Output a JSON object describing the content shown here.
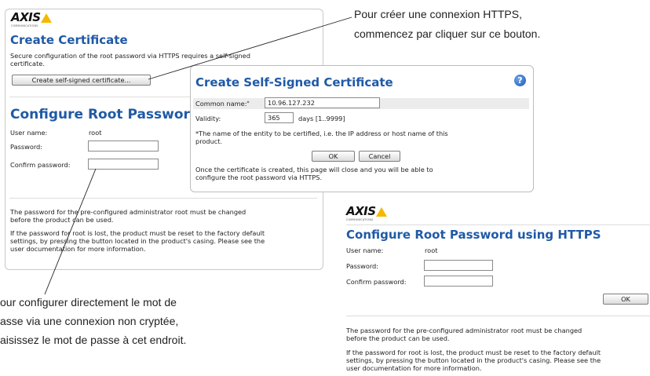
{
  "brand": {
    "name": "AXIS",
    "tagline": "COMMUNICATIONS",
    "accent": "#f5b800"
  },
  "colors": {
    "heading": "#1f5aa6",
    "help_icon": "#1f57b5"
  },
  "left_panel": {
    "create_certificate_title": "Create Certificate",
    "create_certificate_desc_1": "Secure configuration of the root password via HTTPS requires a self-signed",
    "create_certificate_desc_2": "certificate.",
    "create_button": "Create self-signed certificate...",
    "configure_title": "Configure Root Password",
    "user_name_label": "User name:",
    "user_name_value": "root",
    "password_label": "Password:",
    "confirm_label": "Confirm password:",
    "note_1a": "The password for the pre-configured administrator root must be changed",
    "note_1b": "before the product can be used.",
    "note_2a": "If the password for root is lost, the product must be reset to the factory default",
    "note_2b": "settings, by pressing the button located in the product's casing. Please see the",
    "note_2c": "user documentation for more information."
  },
  "dialog": {
    "title": "Create Self-Signed Certificate",
    "help_icon": "?",
    "common_name_label": "Common name:",
    "required_mark": "*",
    "common_name_value": "10.96.127.232",
    "validity_label": "Validity:",
    "validity_value": "365",
    "validity_unit": "days [1..9999]",
    "footnote_1": "*The name of the entity to be certified, i.e. the IP address or host name of this",
    "footnote_2": "product.",
    "ok": "OK",
    "cancel": "Cancel",
    "info_1": "Once the certificate is created, this page will close and you will be able to",
    "info_2": "configure the root password via HTTPS."
  },
  "https_panel": {
    "title": "Configure Root Password using HTTPS",
    "user_name_label": "User name:",
    "user_name_value": "root",
    "password_label": "Password:",
    "confirm_label": "Confirm password:",
    "ok": "OK",
    "note_1a": "The password for the pre-configured administrator root must be changed",
    "note_1b": "before the product can be used.",
    "note_2a": "If the password for root is lost, the product must be reset to the factory default",
    "note_2b": "settings, by pressing the button located in the product's casing. Please see the",
    "note_2c": "user documentation for more information."
  },
  "callouts": {
    "top_1": "Pour créer une connexion HTTPS,",
    "top_2": "commencez par cliquer sur ce bouton.",
    "bottom_1": "our configurer directement le mot de",
    "bottom_2": "asse via une connexion non cryptée,",
    "bottom_3": "aisissez le mot de passe à cet endroit."
  }
}
